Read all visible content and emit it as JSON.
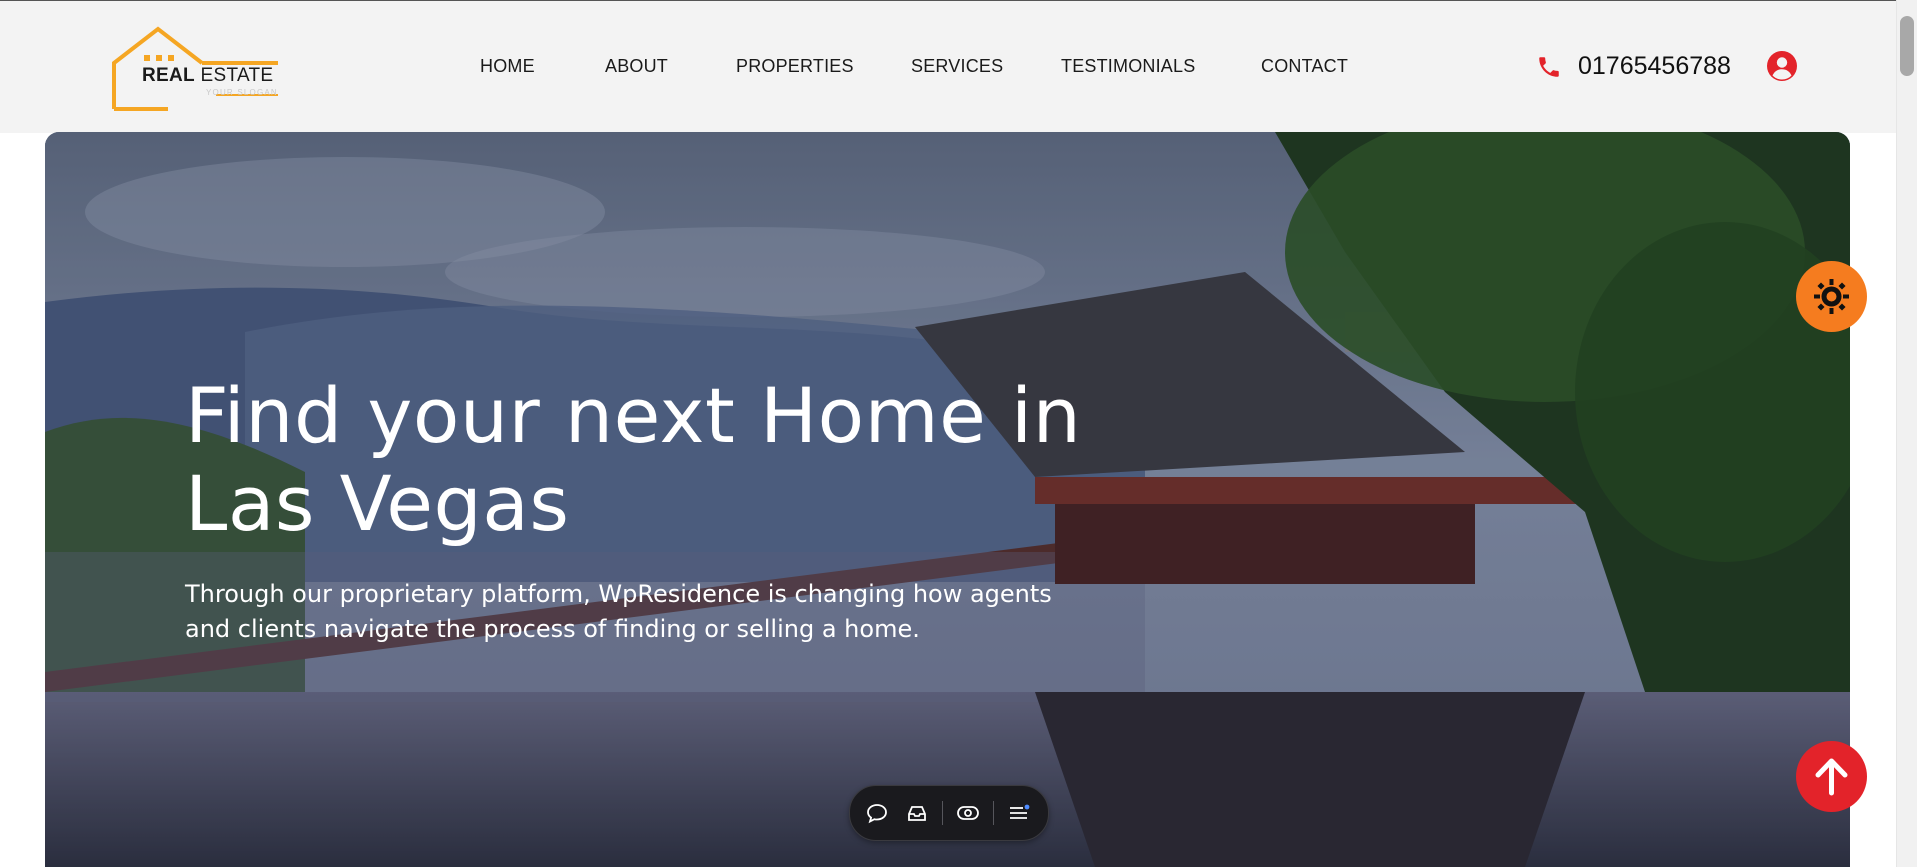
{
  "logo": {
    "title_bold": "REAL",
    "title_rest": "ESTATE",
    "slogan": "YOUR SLOGAN",
    "color": "#f5a623"
  },
  "nav": {
    "items": [
      {
        "label": "HOME"
      },
      {
        "label": "ABOUT"
      },
      {
        "label": "PROPERTIES"
      },
      {
        "label": "SERVICES"
      },
      {
        "label": "TESTIMONIALS"
      },
      {
        "label": "CONTACT"
      }
    ]
  },
  "header": {
    "phone": "01765456788",
    "phone_icon": "phone-icon",
    "user_icon": "user-circle-icon",
    "accent": "#e3232a"
  },
  "hero": {
    "title_line1": "Find your next Home in",
    "title_line2": "Las Vegas",
    "subtitle": "Through our proprietary platform, WpResidence is changing how agents and clients navigate the process of finding or selling a home."
  },
  "toolbar": {
    "icons": [
      "comment-icon",
      "inbox-icon",
      "eye-icon",
      "list-icon"
    ]
  },
  "floating": {
    "theme_icon": "sun-icon",
    "theme_color": "#f57c1f",
    "top_icon": "arrow-up-icon",
    "top_color": "#e3232a"
  }
}
